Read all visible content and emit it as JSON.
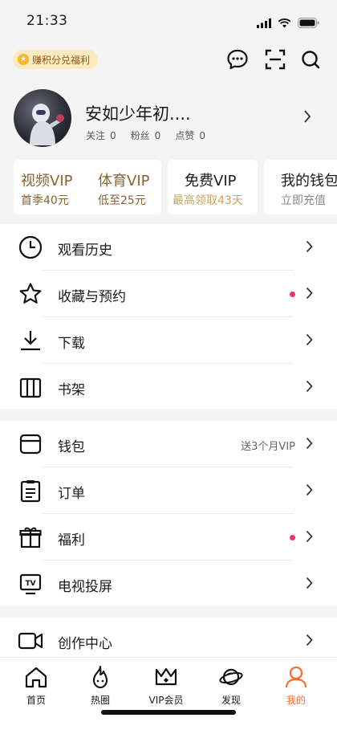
{
  "status_bar": {
    "time": "21:33"
  },
  "top_bar": {
    "earn_badge": "赚积分兑福利"
  },
  "profile": {
    "username": "安如少年初....",
    "following_label": "关注",
    "following_count": "0",
    "fans_label": "粉丝",
    "fans_count": "0",
    "likes_label": "点赞",
    "likes_count": "0"
  },
  "vip_cards": [
    {
      "title": "视频VIP",
      "subtitle": "首季40元"
    },
    {
      "title": "体育VIP",
      "subtitle": "低至25元"
    },
    {
      "title": "免费VIP",
      "subtitle": "最高领取43天"
    },
    {
      "title": "我的钱包",
      "subtitle": "立即充值"
    }
  ],
  "menu_group_1": [
    {
      "label": "观看历史",
      "icon": "clock-icon"
    },
    {
      "label": "收藏与预约",
      "icon": "star-icon",
      "dot": true
    },
    {
      "label": "下载",
      "icon": "download-icon"
    },
    {
      "label": "书架",
      "icon": "bookshelf-icon"
    }
  ],
  "menu_group_2": [
    {
      "label": "钱包",
      "icon": "wallet-icon",
      "extra": "送3个月VIP"
    },
    {
      "label": "订单",
      "icon": "order-icon"
    },
    {
      "label": "福利",
      "icon": "gift-icon",
      "dot": true
    },
    {
      "label": "电视投屏",
      "icon": "tv-icon"
    }
  ],
  "menu_group_3": [
    {
      "label": "创作中心",
      "icon": "video-camera-icon"
    }
  ],
  "tabs": [
    {
      "label": "首页",
      "icon": "home-icon"
    },
    {
      "label": "热圈",
      "icon": "flame-icon"
    },
    {
      "label": "VIP会员",
      "icon": "crown-icon"
    },
    {
      "label": "发现",
      "icon": "planet-icon"
    },
    {
      "label": "我的",
      "icon": "user-icon",
      "active": true
    }
  ],
  "colors": {
    "vip_gold": "#8a6330",
    "vip_gold_light": "#c8a35c",
    "accent_orange": "#ff6a2c",
    "dot_red": "#f0306a",
    "badge_bg": "#fbe9bf"
  }
}
